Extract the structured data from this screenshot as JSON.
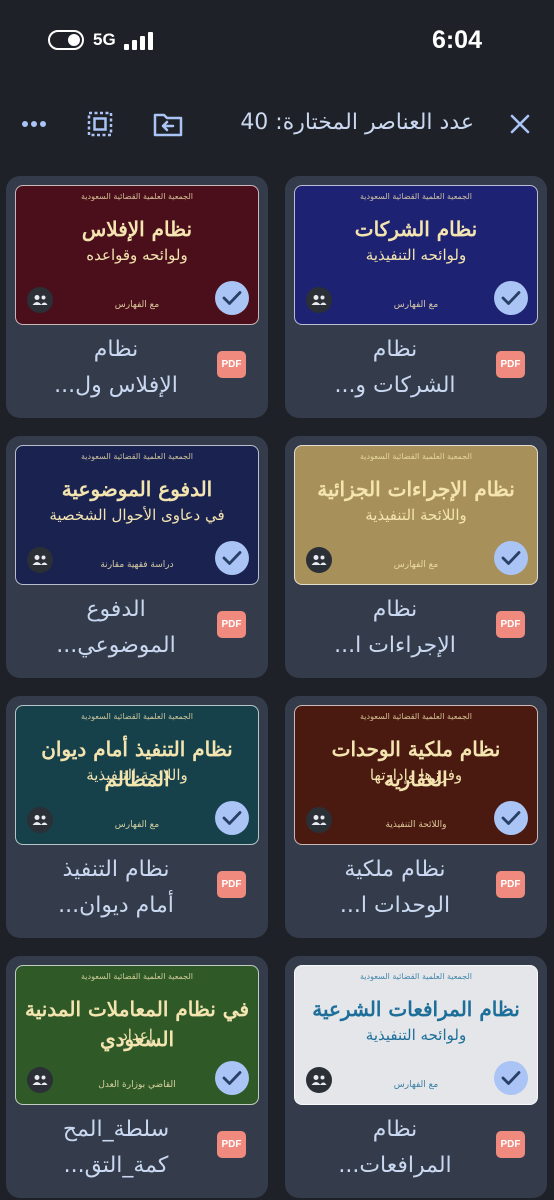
{
  "status": {
    "network": "5G",
    "time": "6:04"
  },
  "toolbar": {
    "title": "عدد العناصر المختارة: 40",
    "close_icon": "close-icon",
    "move_icon": "folder-move-icon",
    "select_all_icon": "select-all-icon",
    "more_icon": "more-horizontal-icon"
  },
  "colors": {
    "background": "#1e2127",
    "card": "#343c4b",
    "text": "#c9d8f0",
    "check": "#a9c4f5",
    "pdf": "#f08a7e"
  },
  "files": [
    {
      "line1": "نظام",
      "line2": "الشركات و...",
      "type": "PDF",
      "cover_title": "نظام الشركات",
      "cover_sub": "ولوائحه التنفيذية",
      "cover_small": "مع الفهارس",
      "cover_color": "#1e2272",
      "selected": true
    },
    {
      "line1": "نظام",
      "line2": "الإفلاس ول...",
      "type": "PDF",
      "cover_title": "نظام الإفلاس",
      "cover_sub": "ولوائحه وقواعده",
      "cover_small": "مع الفهارس",
      "cover_color": "#4a0f1a",
      "selected": true
    },
    {
      "line1": "نظام",
      "line2": "الإجراءات ا...",
      "type": "PDF",
      "cover_title": "نظام الإجراءات الجزائية",
      "cover_sub": "واللائحة التنفيذية",
      "cover_small": "مع الفهارس",
      "cover_color": "#a8905a",
      "selected": true
    },
    {
      "line1": "الدفوع",
      "line2": "الموضوعي...",
      "type": "PDF",
      "cover_title": "الدفوع الموضوعية",
      "cover_sub": "في دعاوى الأحوال الشخصية",
      "cover_small": "دراسة فقهية مقارنة",
      "cover_color": "#1a2350",
      "selected": true
    },
    {
      "line1": "نظام ملكية",
      "line2": "الوحدات ا...",
      "type": "PDF",
      "cover_title": "نظام ملكية الوحدات العقارية",
      "cover_sub": "وفرزها وإدارتها",
      "cover_small": "واللائحة التنفيذية",
      "cover_color": "#4a1a10",
      "selected": true
    },
    {
      "line1": "نظام التنفيذ",
      "line2": "أمام ديوان...",
      "type": "PDF",
      "cover_title": "نظام التنفيذ أمام ديوان المظالم",
      "cover_sub": "واللائحة التنفيذية",
      "cover_small": "مع الفهارس",
      "cover_color": "#16404a",
      "selected": true
    },
    {
      "line1": "نظام",
      "line2": "المرافعات...",
      "type": "PDF",
      "cover_title": "نظام المرافعات الشرعية",
      "cover_sub": "ولوائحه التنفيذية",
      "cover_small": "مع الفهارس",
      "cover_color": "#e4e6ea",
      "selected": true
    },
    {
      "line1": "سلطة_المح",
      "line2": "كمة_التق...",
      "type": "PDF",
      "cover_title": "في نظام المعاملات المدنية السعودي",
      "cover_sub": "إعداد",
      "cover_small": "القاضي بوزارة العدل",
      "cover_color": "#2f5a28",
      "selected": true
    }
  ]
}
